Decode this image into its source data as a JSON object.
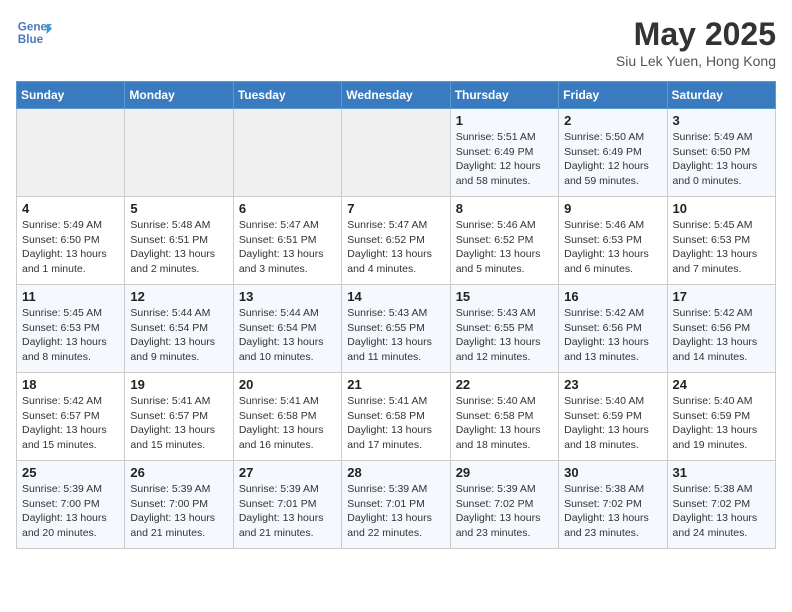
{
  "header": {
    "logo_line1": "General",
    "logo_line2": "Blue",
    "month_title": "May 2025",
    "location": "Siu Lek Yuen, Hong Kong"
  },
  "days_of_week": [
    "Sunday",
    "Monday",
    "Tuesday",
    "Wednesday",
    "Thursday",
    "Friday",
    "Saturday"
  ],
  "weeks": [
    [
      {
        "day": "",
        "detail": ""
      },
      {
        "day": "",
        "detail": ""
      },
      {
        "day": "",
        "detail": ""
      },
      {
        "day": "",
        "detail": ""
      },
      {
        "day": "1",
        "detail": "Sunrise: 5:51 AM\nSunset: 6:49 PM\nDaylight: 12 hours\nand 58 minutes."
      },
      {
        "day": "2",
        "detail": "Sunrise: 5:50 AM\nSunset: 6:49 PM\nDaylight: 12 hours\nand 59 minutes."
      },
      {
        "day": "3",
        "detail": "Sunrise: 5:49 AM\nSunset: 6:50 PM\nDaylight: 13 hours\nand 0 minutes."
      }
    ],
    [
      {
        "day": "4",
        "detail": "Sunrise: 5:49 AM\nSunset: 6:50 PM\nDaylight: 13 hours\nand 1 minute."
      },
      {
        "day": "5",
        "detail": "Sunrise: 5:48 AM\nSunset: 6:51 PM\nDaylight: 13 hours\nand 2 minutes."
      },
      {
        "day": "6",
        "detail": "Sunrise: 5:47 AM\nSunset: 6:51 PM\nDaylight: 13 hours\nand 3 minutes."
      },
      {
        "day": "7",
        "detail": "Sunrise: 5:47 AM\nSunset: 6:52 PM\nDaylight: 13 hours\nand 4 minutes."
      },
      {
        "day": "8",
        "detail": "Sunrise: 5:46 AM\nSunset: 6:52 PM\nDaylight: 13 hours\nand 5 minutes."
      },
      {
        "day": "9",
        "detail": "Sunrise: 5:46 AM\nSunset: 6:53 PM\nDaylight: 13 hours\nand 6 minutes."
      },
      {
        "day": "10",
        "detail": "Sunrise: 5:45 AM\nSunset: 6:53 PM\nDaylight: 13 hours\nand 7 minutes."
      }
    ],
    [
      {
        "day": "11",
        "detail": "Sunrise: 5:45 AM\nSunset: 6:53 PM\nDaylight: 13 hours\nand 8 minutes."
      },
      {
        "day": "12",
        "detail": "Sunrise: 5:44 AM\nSunset: 6:54 PM\nDaylight: 13 hours\nand 9 minutes."
      },
      {
        "day": "13",
        "detail": "Sunrise: 5:44 AM\nSunset: 6:54 PM\nDaylight: 13 hours\nand 10 minutes."
      },
      {
        "day": "14",
        "detail": "Sunrise: 5:43 AM\nSunset: 6:55 PM\nDaylight: 13 hours\nand 11 minutes."
      },
      {
        "day": "15",
        "detail": "Sunrise: 5:43 AM\nSunset: 6:55 PM\nDaylight: 13 hours\nand 12 minutes."
      },
      {
        "day": "16",
        "detail": "Sunrise: 5:42 AM\nSunset: 6:56 PM\nDaylight: 13 hours\nand 13 minutes."
      },
      {
        "day": "17",
        "detail": "Sunrise: 5:42 AM\nSunset: 6:56 PM\nDaylight: 13 hours\nand 14 minutes."
      }
    ],
    [
      {
        "day": "18",
        "detail": "Sunrise: 5:42 AM\nSunset: 6:57 PM\nDaylight: 13 hours\nand 15 minutes."
      },
      {
        "day": "19",
        "detail": "Sunrise: 5:41 AM\nSunset: 6:57 PM\nDaylight: 13 hours\nand 15 minutes."
      },
      {
        "day": "20",
        "detail": "Sunrise: 5:41 AM\nSunset: 6:58 PM\nDaylight: 13 hours\nand 16 minutes."
      },
      {
        "day": "21",
        "detail": "Sunrise: 5:41 AM\nSunset: 6:58 PM\nDaylight: 13 hours\nand 17 minutes."
      },
      {
        "day": "22",
        "detail": "Sunrise: 5:40 AM\nSunset: 6:58 PM\nDaylight: 13 hours\nand 18 minutes."
      },
      {
        "day": "23",
        "detail": "Sunrise: 5:40 AM\nSunset: 6:59 PM\nDaylight: 13 hours\nand 18 minutes."
      },
      {
        "day": "24",
        "detail": "Sunrise: 5:40 AM\nSunset: 6:59 PM\nDaylight: 13 hours\nand 19 minutes."
      }
    ],
    [
      {
        "day": "25",
        "detail": "Sunrise: 5:39 AM\nSunset: 7:00 PM\nDaylight: 13 hours\nand 20 minutes."
      },
      {
        "day": "26",
        "detail": "Sunrise: 5:39 AM\nSunset: 7:00 PM\nDaylight: 13 hours\nand 21 minutes."
      },
      {
        "day": "27",
        "detail": "Sunrise: 5:39 AM\nSunset: 7:01 PM\nDaylight: 13 hours\nand 21 minutes."
      },
      {
        "day": "28",
        "detail": "Sunrise: 5:39 AM\nSunset: 7:01 PM\nDaylight: 13 hours\nand 22 minutes."
      },
      {
        "day": "29",
        "detail": "Sunrise: 5:39 AM\nSunset: 7:02 PM\nDaylight: 13 hours\nand 23 minutes."
      },
      {
        "day": "30",
        "detail": "Sunrise: 5:38 AM\nSunset: 7:02 PM\nDaylight: 13 hours\nand 23 minutes."
      },
      {
        "day": "31",
        "detail": "Sunrise: 5:38 AM\nSunset: 7:02 PM\nDaylight: 13 hours\nand 24 minutes."
      }
    ]
  ]
}
